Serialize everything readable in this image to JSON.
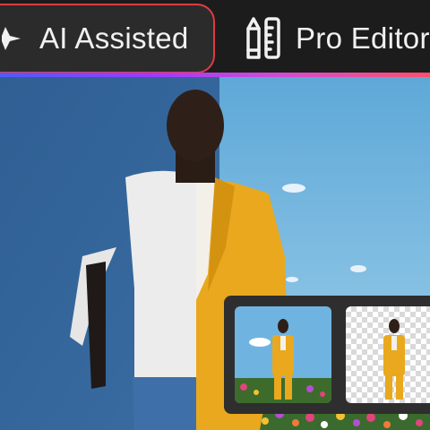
{
  "toolbar": {
    "modes": [
      {
        "label": "AI Assisted",
        "icon": "sparkle-icon",
        "selected": true
      },
      {
        "label": "Pro Editor",
        "icon": "pencil-ruler-icon",
        "selected": false
      }
    ],
    "accent_colors": [
      "#4b5cff",
      "#9a3cff",
      "#d24bd2",
      "#ff4f6b"
    ],
    "selection_outline_color": "#e03b42"
  },
  "canvas": {
    "subject": "man in white t-shirt / yellow suit",
    "left_half": "original photo, blue wall background",
    "right_half": "edited photo, sky and flower field background"
  },
  "thumbnails": [
    {
      "kind": "original-photo-thumbnail"
    },
    {
      "kind": "background-removed-thumbnail"
    }
  ]
}
